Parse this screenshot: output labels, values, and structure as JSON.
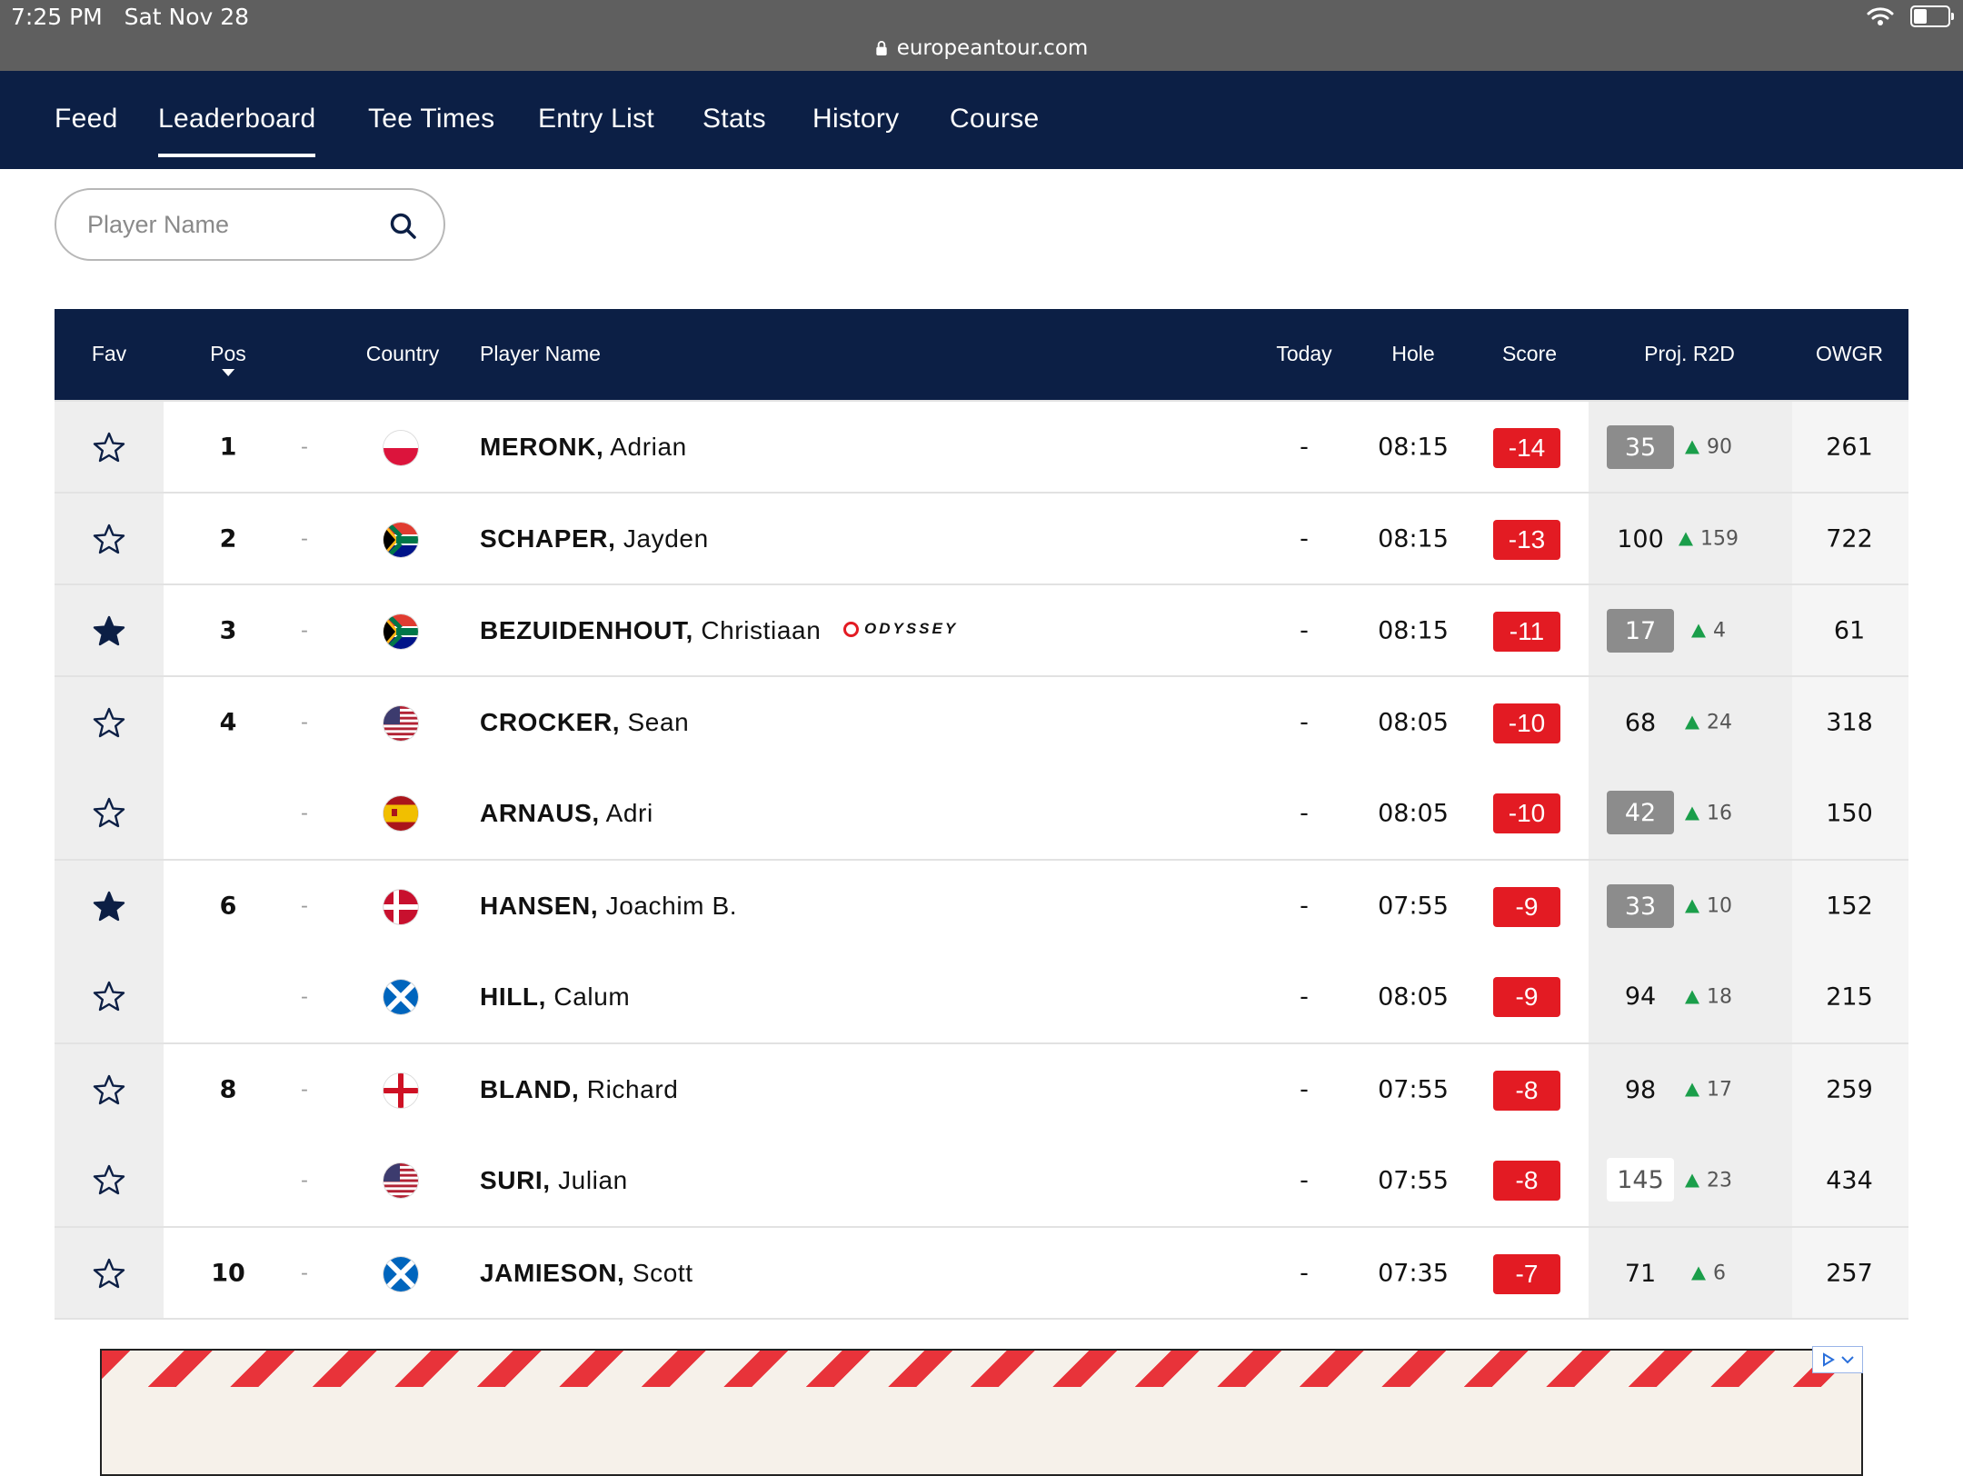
{
  "status_bar": {
    "time": "7:25 PM",
    "date": "Sat Nov 28",
    "url": "europeantour.com"
  },
  "nav": {
    "items": [
      {
        "label": "Feed"
      },
      {
        "label": "Leaderboard",
        "active": true
      },
      {
        "label": "Tee Times"
      },
      {
        "label": "Entry List"
      },
      {
        "label": "Stats"
      },
      {
        "label": "History"
      },
      {
        "label": "Course"
      }
    ]
  },
  "search": {
    "placeholder": "Player Name"
  },
  "table": {
    "headers": {
      "fav": "Fav",
      "pos": "Pos",
      "country": "Country",
      "player": "Player Name",
      "today": "Today",
      "hole": "Hole",
      "score": "Score",
      "proj": "Proj. R2D",
      "owgr": "OWGR"
    },
    "rows": [
      {
        "fav": false,
        "pos": "1",
        "move": "-",
        "flag": "poland",
        "last": "MERONK,",
        "first": "Adrian",
        "today": "-",
        "hole": "08:15",
        "score": "-14",
        "proj": "35",
        "proj_style": "grey",
        "proj_move": "90",
        "owgr": "261"
      },
      {
        "fav": false,
        "pos": "2",
        "move": "-",
        "flag": "south-africa",
        "last": "SCHAPER,",
        "first": "Jayden",
        "today": "-",
        "hole": "08:15",
        "score": "-13",
        "proj": "100",
        "proj_style": "plain",
        "proj_move": "159",
        "owgr": "722"
      },
      {
        "fav": true,
        "pos": "3",
        "move": "-",
        "flag": "south-africa",
        "last": "BEZUIDENHOUT,",
        "first": "Christiaan",
        "sponsor": "ODYSSEY",
        "today": "-",
        "hole": "08:15",
        "score": "-11",
        "proj": "17",
        "proj_style": "grey",
        "proj_move": "4",
        "owgr": "61"
      },
      {
        "fav": false,
        "pos": "4",
        "move": "-",
        "flag": "usa",
        "last": "CROCKER,",
        "first": "Sean",
        "today": "-",
        "hole": "08:05",
        "score": "-10",
        "proj": "68",
        "proj_style": "plain",
        "proj_move": "24",
        "owgr": "318"
      },
      {
        "fav": false,
        "pos": "",
        "move": "-",
        "flag": "spain",
        "last": "ARNAUS,",
        "first": "Adri",
        "today": "-",
        "hole": "08:05",
        "score": "-10",
        "proj": "42",
        "proj_style": "grey",
        "proj_move": "16",
        "owgr": "150"
      },
      {
        "fav": true,
        "pos": "6",
        "move": "-",
        "flag": "denmark",
        "last": "HANSEN,",
        "first": "Joachim B.",
        "today": "-",
        "hole": "07:55",
        "score": "-9",
        "proj": "33",
        "proj_style": "grey",
        "proj_move": "10",
        "owgr": "152"
      },
      {
        "fav": false,
        "pos": "",
        "move": "-",
        "flag": "scotland",
        "last": "HILL,",
        "first": "Calum",
        "today": "-",
        "hole": "08:05",
        "score": "-9",
        "proj": "94",
        "proj_style": "plain",
        "proj_move": "18",
        "owgr": "215"
      },
      {
        "fav": false,
        "pos": "8",
        "move": "-",
        "flag": "england",
        "last": "BLAND,",
        "first": "Richard",
        "today": "-",
        "hole": "07:55",
        "score": "-8",
        "proj": "98",
        "proj_style": "plain",
        "proj_move": "17",
        "owgr": "259"
      },
      {
        "fav": false,
        "pos": "",
        "move": "-",
        "flag": "usa",
        "last": "SURI,",
        "first": "Julian",
        "today": "-",
        "hole": "07:55",
        "score": "-8",
        "proj": "145",
        "proj_style": "white",
        "proj_move": "23",
        "owgr": "434"
      },
      {
        "fav": false,
        "pos": "10",
        "move": "-",
        "flag": "scotland",
        "last": "JAMIESON,",
        "first": "Scott",
        "today": "-",
        "hole": "07:35",
        "score": "-7",
        "proj": "71",
        "proj_style": "plain",
        "proj_move": "6",
        "owgr": "257"
      }
    ]
  },
  "colors": {
    "nav_bg": "#0c1f45",
    "score_red": "#e31b23",
    "proj_grey": "#8c8c8c",
    "up_green": "#1a9e4a"
  }
}
